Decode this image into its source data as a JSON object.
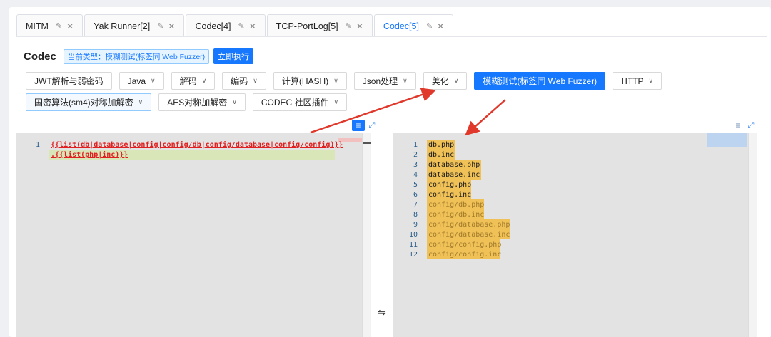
{
  "tabs": [
    {
      "label": "MITM",
      "active": false
    },
    {
      "label": "Yak Runner[2]",
      "active": false
    },
    {
      "label": "Codec[4]",
      "active": false
    },
    {
      "label": "TCP-PortLog[5]",
      "active": false
    },
    {
      "label": "Codec[5]",
      "active": true
    }
  ],
  "tab_icons": {
    "edit": "✎",
    "close": "✕"
  },
  "header": {
    "title": "Codec",
    "type_tag": "当前类型：模糊测试(标签同 Web Fuzzer)",
    "exec_button": "立即执行"
  },
  "toolbar": {
    "row1": [
      {
        "label": "JWT解析与弱密码",
        "dropdown": false
      },
      {
        "label": "Java",
        "dropdown": true
      },
      {
        "label": "解码",
        "dropdown": true
      },
      {
        "label": "编码",
        "dropdown": true
      },
      {
        "label": "计算(HASH)",
        "dropdown": true
      },
      {
        "label": "Json处理",
        "dropdown": true
      },
      {
        "label": "美化",
        "dropdown": true
      },
      {
        "label": "模糊测试(标签同 Web Fuzzer)",
        "dropdown": false,
        "primary": true
      },
      {
        "label": "HTTP",
        "dropdown": true
      }
    ],
    "row2": [
      {
        "label": "国密算法(sm4)对称加解密",
        "dropdown": true,
        "outlined": true
      },
      {
        "label": "AES对称加解密",
        "dropdown": true
      },
      {
        "label": "CODEC 社区插件",
        "dropdown": true
      }
    ],
    "chevron": "∨"
  },
  "input_editor": {
    "line_numbers": [
      "1"
    ],
    "lines": [
      "{{list(db|database|config|config/db|config/database|config/config)}}",
      ".{{list(php|inc)}}"
    ],
    "wrap_icon": "≡",
    "expand_icon": "⤢"
  },
  "output_editor": {
    "line_numbers": [
      "1",
      "2",
      "3",
      "4",
      "5",
      "6",
      "7",
      "8",
      "9",
      "10",
      "11",
      "12"
    ],
    "lines": [
      "db.php",
      "db.inc",
      "database.php",
      "database.inc",
      "config.php",
      "config.inc",
      "config/db.php",
      "config/db.inc",
      "config/database.php",
      "config/database.inc",
      "config/config.php",
      "config/config.inc"
    ],
    "wrap_icon": "≡",
    "expand_icon": "⤢"
  },
  "swap_icon": "⇋",
  "colors": {
    "accent": "#1677ff",
    "arrow": "#e0382b",
    "highlight": "#f0c157",
    "error_text": "#e02020"
  }
}
